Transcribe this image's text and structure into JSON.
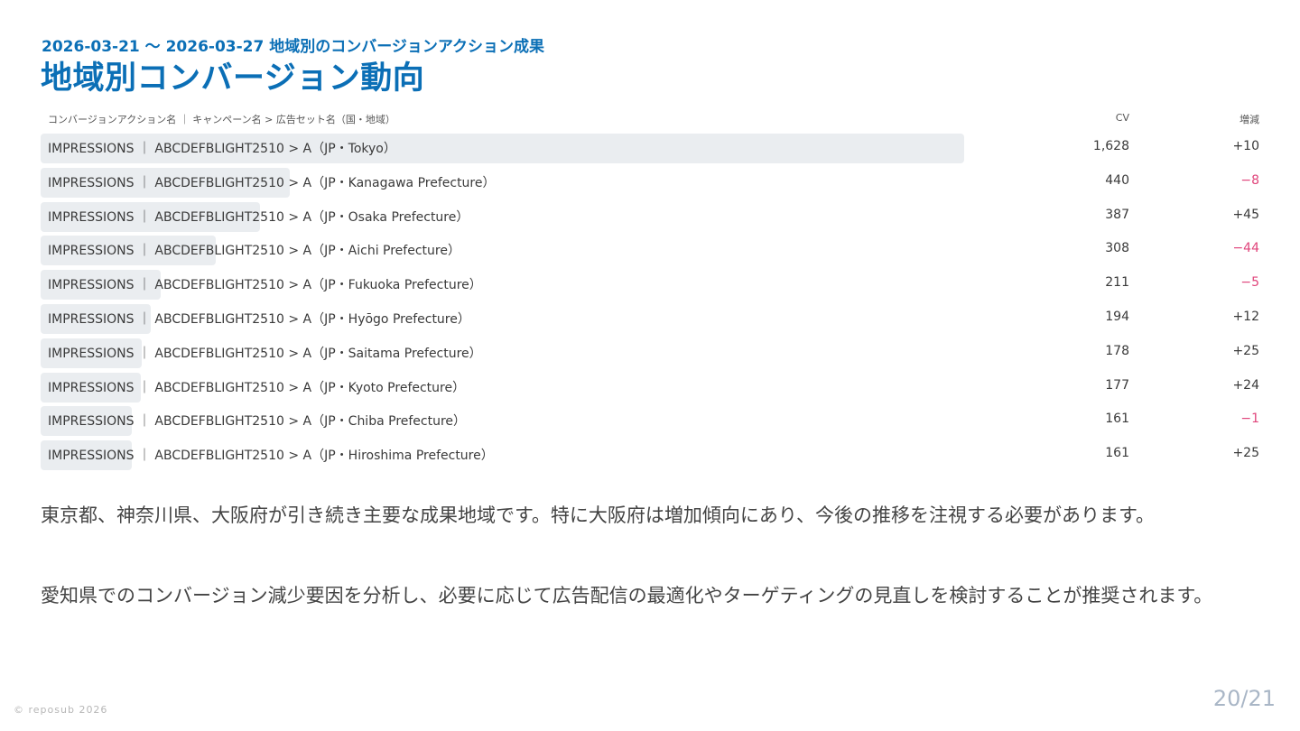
{
  "header": {
    "subtitle": "2026-03-21 〜 2026-03-27 地域別のコンバージョンアクション成果",
    "title": "地域別コンバージョン動向"
  },
  "table": {
    "columns": {
      "name": "コンバージョンアクション名 ｜ キャンペーン名 > 広告セット名（国・地域）",
      "cv": "CV",
      "diff": "増減"
    },
    "rows": [
      {
        "label": "IMPRESSIONS ｜ ABCDEFBLIGHT2510 > A（JP・Tokyo）",
        "cv": "1,628",
        "cv_value": 1628,
        "diff": "+10",
        "negative": false
      },
      {
        "label": "IMPRESSIONS ｜ ABCDEFBLIGHT2510 > A（JP・Kanagawa Prefecture）",
        "cv": "440",
        "cv_value": 440,
        "diff": "−8",
        "negative": true
      },
      {
        "label": "IMPRESSIONS ｜ ABCDEFBLIGHT2510 > A（JP・Osaka Prefecture）",
        "cv": "387",
        "cv_value": 387,
        "diff": "+45",
        "negative": false
      },
      {
        "label": "IMPRESSIONS ｜ ABCDEFBLIGHT2510 > A（JP・Aichi Prefecture）",
        "cv": "308",
        "cv_value": 308,
        "diff": "−44",
        "negative": true
      },
      {
        "label": "IMPRESSIONS ｜ ABCDEFBLIGHT2510 > A（JP・Fukuoka Prefecture）",
        "cv": "211",
        "cv_value": 211,
        "diff": "−5",
        "negative": true
      },
      {
        "label": "IMPRESSIONS ｜ ABCDEFBLIGHT2510 > A（JP・Hyōgo Prefecture）",
        "cv": "194",
        "cv_value": 194,
        "diff": "+12",
        "negative": false
      },
      {
        "label": "IMPRESSIONS ｜ ABCDEFBLIGHT2510 > A（JP・Saitama Prefecture）",
        "cv": "178",
        "cv_value": 178,
        "diff": "+25",
        "negative": false
      },
      {
        "label": "IMPRESSIONS ｜ ABCDEFBLIGHT2510 > A（JP・Kyoto Prefecture）",
        "cv": "177",
        "cv_value": 177,
        "diff": "+24",
        "negative": false
      },
      {
        "label": "IMPRESSIONS ｜ ABCDEFBLIGHT2510 > A（JP・Chiba Prefecture）",
        "cv": "161",
        "cv_value": 161,
        "diff": "−1",
        "negative": true
      },
      {
        "label": "IMPRESSIONS ｜ ABCDEFBLIGHT2510 > A（JP・Hiroshima Prefecture）",
        "cv": "161",
        "cv_value": 161,
        "diff": "+25",
        "negative": false
      }
    ]
  },
  "paragraphs": [
    "東京都、神奈川県、大阪府が引き続き主要な成果地域です。特に大阪府は増加傾向にあり、今後の推移を注視する必要があります。",
    "愛知県でのコンバージョン減少要因を分析し、必要に応じて広告配信の最適化やターゲティングの見直しを検討することが推奨されます。"
  ],
  "footer": {
    "copyright": "© reposub 2026",
    "page": "20/21"
  },
  "colors": {
    "accent": "#0b6fb6",
    "negative": "#e0457b",
    "bar": "#eaedf0"
  }
}
